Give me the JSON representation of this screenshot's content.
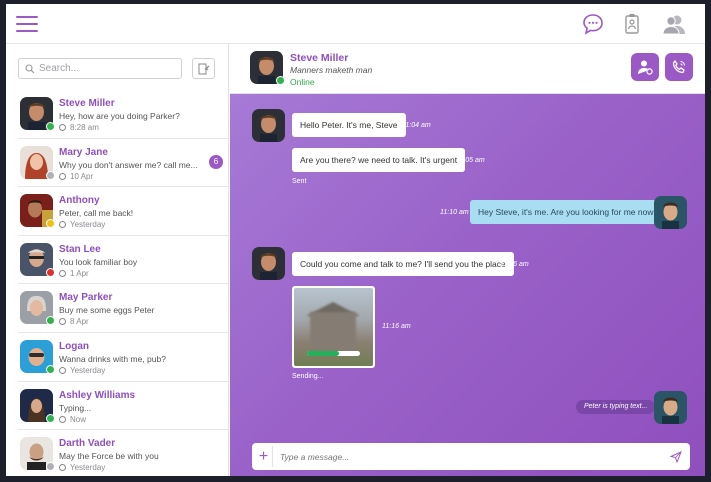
{
  "search": {
    "placeholder": "Search..."
  },
  "contacts": [
    {
      "name": "Steve Miller",
      "message": "Hey, how are you doing  Parker?",
      "time": "8:28 am",
      "status": "#2fb34f"
    },
    {
      "name": "Mary Jane",
      "message": "Why you don't answer me? call me...",
      "time": "10 Apr",
      "status": "#b0b0b8",
      "unread": "6"
    },
    {
      "name": "Anthony",
      "message": "Peter, call me back!",
      "time": "Yesterday",
      "status": "#f2c012"
    },
    {
      "name": "Stan Lee",
      "message": "You look familiar boy",
      "time": "1 Apr",
      "status": "#e0312d"
    },
    {
      "name": "May Parker",
      "message": "Buy me some eggs Peter",
      "time": "8 Apr",
      "status": "#2fb34f"
    },
    {
      "name": "Logan",
      "message": "Wanna drinks with me, pub?",
      "time": "Yesterday",
      "status": "#2fb34f"
    },
    {
      "name": "Ashley Williams",
      "message": "Typing...",
      "time": "Now",
      "status": "#2fb34f"
    },
    {
      "name": "Darth Vader",
      "message": "May the Force be with you",
      "time": "Yesterday",
      "status": "#b0b0b8"
    }
  ],
  "chat_header": {
    "name": "Steve Miller",
    "subtitle": "Manners maketh man",
    "status": "Online"
  },
  "messages": {
    "m1": {
      "text": "Hello Peter. It's me, Steve",
      "time": "11:04 am"
    },
    "m2": {
      "text": "Are you there? we need to talk. It's urgent",
      "time": "11:05 am",
      "note": "Sent"
    },
    "m3": {
      "text": "Hey Steve, it's me. Are you looking for me now?",
      "time": "11:10 am"
    },
    "m4": {
      "text": "Could you come and talk to me? I'll send you the place",
      "time": "11:16 am"
    },
    "m5": {
      "time": "11:16 am",
      "note": "Sending...",
      "progress": 0.6
    }
  },
  "typing": "Peter is typing text...",
  "composer": {
    "placeholder": "Type a message..."
  },
  "colors": {
    "accent": "#9b59c6",
    "online": "#2aa94a",
    "my_bubble": "#a9ddf2"
  }
}
